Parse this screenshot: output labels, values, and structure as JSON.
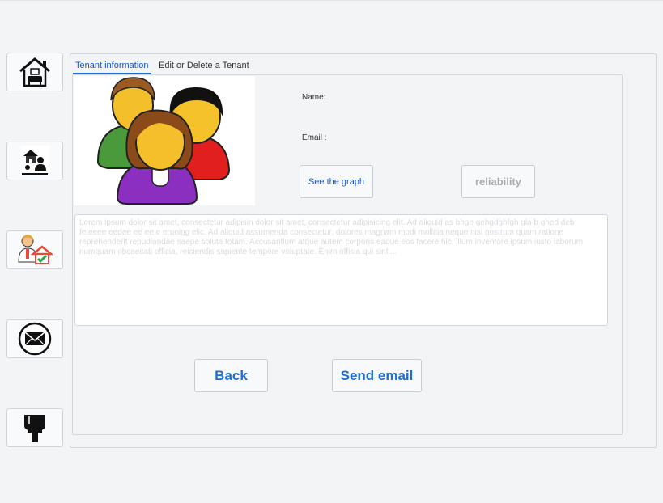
{
  "sidebar": {
    "items": [
      {
        "icon": "house-furniture-icon"
      },
      {
        "icon": "property-agent-icon"
      },
      {
        "icon": "tenant-house-icon"
      },
      {
        "icon": "envelope-icon"
      },
      {
        "icon": "paint-brush-icon"
      }
    ]
  },
  "tabs": [
    {
      "label": "Tenant information",
      "active": true
    },
    {
      "label": "Edit or Delete a Tenant",
      "active": false
    }
  ],
  "tenant": {
    "name_label": "Name:",
    "email_label": "Email :",
    "avatar_icon": "people-group-icon"
  },
  "buttons": {
    "graph": "See the graph",
    "reliability": "reliability",
    "back": "Back",
    "send_email": "Send email"
  },
  "notes": {
    "text": "Lorem ipsum dolor sit amet, consectetur adipisin dolor sit amet, consectetur adipisicing elit. Ad aliquid as bhge gehgdghfgh gla b  ghed deb fe:eeee eedee ee ee e eruoing elic. Ad aliquid assumenda consectetur, dolores magnam modi mollitia neque nisi nostrum quam ratione reprehenderit repudiandae saepe soluta totam. Accusantium atque autem corporis eaque eos facere hic, illum inventore ipsum iusto laborum numquam obcaecati officia, reiciendis sapiente tempore voluptate. Enim officia qui sint...."
  },
  "colors": {
    "accent": "#1a6fd6",
    "background": "#f3f4f6",
    "disabled_text": "#a8abb0"
  }
}
